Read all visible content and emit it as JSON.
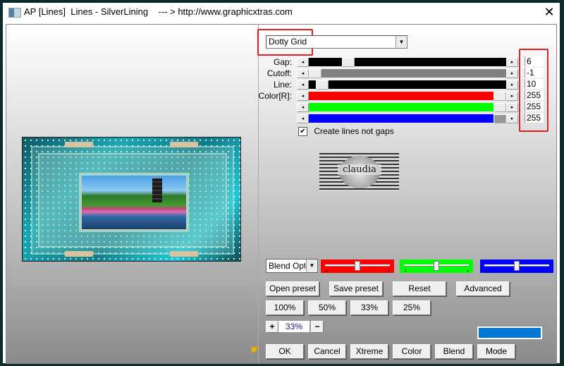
{
  "window": {
    "title": "AP [Lines]  Lines - SilverLining    --- > http://www.graphicxtras.com",
    "close_glyph": "✕"
  },
  "preset_dropdown": {
    "value": "Dotty Grid",
    "arrow": "▼"
  },
  "parameters": [
    {
      "label": "Gap:",
      "value": "6",
      "track_color": "#000000",
      "position": 0.18
    },
    {
      "label": "Cutoff:",
      "value": "-1",
      "track_color": "#808080",
      "position": 0.0
    },
    {
      "label": "Line:",
      "value": "10",
      "track_color": "#000000",
      "position": 0.04
    },
    {
      "label": "Color[R]:",
      "value": "255",
      "track_color": "#ff0000",
      "position": 1.0
    },
    {
      "label": "",
      "value": "255",
      "track_color": "#00ff00",
      "position": 1.0
    },
    {
      "label": "",
      "value": "255",
      "track_color": "#0000ff",
      "position": 1.0
    }
  ],
  "arrows": {
    "left": "◂",
    "right": "▸"
  },
  "checkbox": {
    "label": "Create lines not gaps",
    "checked": true,
    "check_glyph": "✔"
  },
  "logo": {
    "text": "claudia"
  },
  "blend": {
    "select_value": "Blend Options",
    "arrow": "▼",
    "color_sliders": [
      {
        "name": "red",
        "color": "#ff0000",
        "position": 0.5
      },
      {
        "name": "green",
        "color": "#00ff00",
        "position": 0.5
      },
      {
        "name": "blue",
        "color": "#0000ff",
        "position": 0.5
      }
    ]
  },
  "buttons": {
    "open_preset": "Open preset",
    "save_preset": "Save preset",
    "reset": "Reset",
    "advanced": "Advanced",
    "zoom_100": "100%",
    "zoom_50": "50%",
    "zoom_33": "33%",
    "zoom_25": "25%",
    "zoom_plus": "+",
    "zoom_minus": "−",
    "ok": "OK",
    "cancel": "Cancel",
    "xtreme": "Xtreme",
    "color": "Color",
    "blend": "Blend",
    "mode": "Mode"
  },
  "zoom_value": "33%",
  "swatch_color": "#0078d7",
  "pointer_glyph": "☛"
}
